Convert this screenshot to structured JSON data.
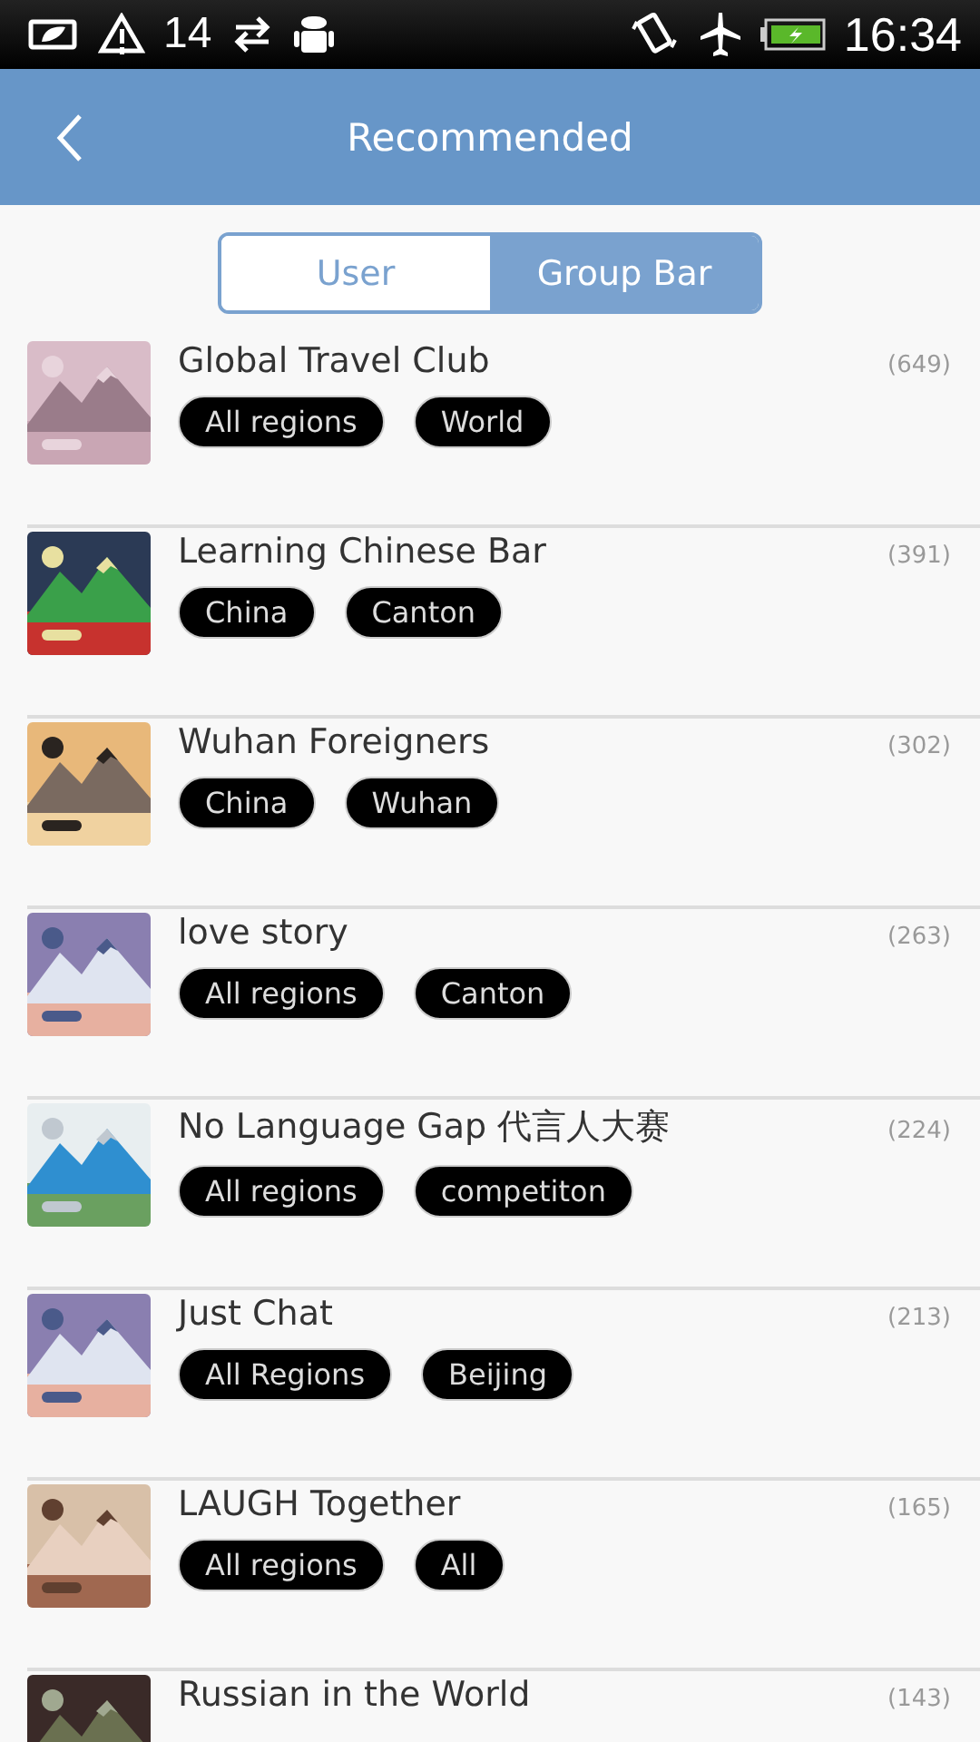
{
  "status_bar": {
    "notification_count": "14",
    "time": "16:34"
  },
  "header": {
    "title": "Recommended"
  },
  "tabs": [
    {
      "label": "User",
      "selected": false
    },
    {
      "label": "Group Bar",
      "selected": true
    }
  ],
  "groups": [
    {
      "name": "Global Travel Club",
      "count": "(649)",
      "tags": [
        "All regions",
        "World"
      ]
    },
    {
      "name": "Learning Chinese Bar",
      "count": "(391)",
      "tags": [
        "China",
        "Canton"
      ]
    },
    {
      "name": "Wuhan Foreigners",
      "count": "(302)",
      "tags": [
        "China",
        "Wuhan"
      ]
    },
    {
      "name": "love story",
      "count": "(263)",
      "tags": [
        "All regions",
        "Canton"
      ]
    },
    {
      "name": "No Language Gap 代言人大赛",
      "count": "(224)",
      "tags": [
        "All regions",
        "competiton"
      ]
    },
    {
      "name": "Just Chat",
      "count": "(213)",
      "tags": [
        "All Regions",
        "Beijing"
      ]
    },
    {
      "name": "LAUGH Together",
      "count": "(165)",
      "tags": [
        "All regions",
        "All"
      ]
    },
    {
      "name": "Russian in the World",
      "count": "(143)"
    }
  ]
}
